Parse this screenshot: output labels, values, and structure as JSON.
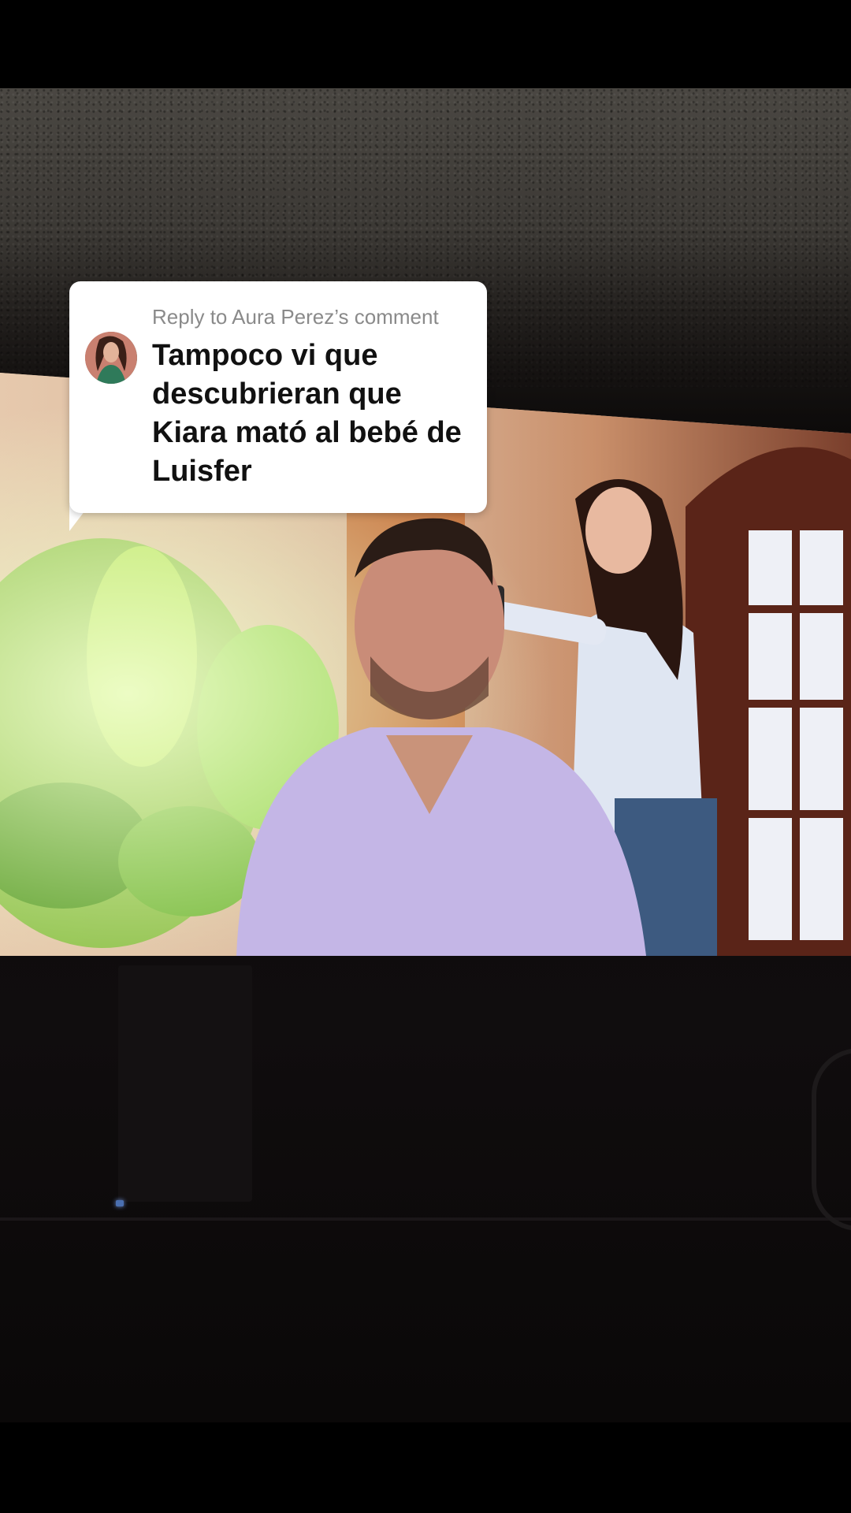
{
  "reply": {
    "header": "Reply to Aura Perez’s comment",
    "text": "Tampoco vi que descubrieran que Kiara mató al bebé de Luisfer"
  },
  "icons": {
    "avatar": "commenter-avatar"
  },
  "colors": {
    "card_background": "#ffffff",
    "header_text": "#8a8a8a",
    "body_text": "#111111"
  }
}
